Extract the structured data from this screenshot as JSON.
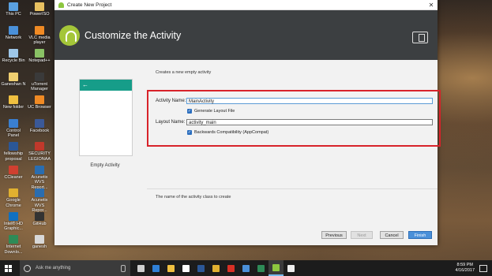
{
  "desktop": {
    "icons": [
      {
        "label": "This PC",
        "color": "#5aa0e0"
      },
      {
        "label": "PowerISO",
        "color": "#e8c060"
      },
      {
        "label": "Network",
        "color": "#4a90d9"
      },
      {
        "label": "VLC media player",
        "color": "#f08a24"
      },
      {
        "label": "Recycle Bin",
        "color": "#9ec7e8"
      },
      {
        "label": "Notepad++",
        "color": "#8ac265"
      },
      {
        "label": "Ganeshan N",
        "color": "#f0d070"
      },
      {
        "label": "uTorrent Manager",
        "color": "#3a3a3a"
      },
      {
        "label": "New folder",
        "color": "#f0c040"
      },
      {
        "label": "UC Browser",
        "color": "#f08a24"
      },
      {
        "label": "Control Panel",
        "color": "#3a7fd0"
      },
      {
        "label": "Facebook",
        "color": "#3b5998"
      },
      {
        "label": "fellowship proposal",
        "color": "#2b5797"
      },
      {
        "label": "SECURITY LEGIONAA",
        "color": "#c0392b"
      },
      {
        "label": "CCleaner",
        "color": "#d04030"
      },
      {
        "label": "Acunetix WVS Report...",
        "color": "#2a6db0"
      },
      {
        "label": "Google Chrome",
        "color": "#e0b030"
      },
      {
        "label": "Acunetix WVS Repor...",
        "color": "#2a6db0"
      },
      {
        "label": "Intel® HD Graphic...",
        "color": "#1070c0"
      },
      {
        "label": "GitHub",
        "color": "#333333"
      },
      {
        "label": "Internet Downlo...",
        "color": "#2e8b57"
      },
      {
        "label": "ganesh",
        "color": "#d8d8d8"
      }
    ]
  },
  "window": {
    "title": "Create New Project",
    "close": "✕",
    "heading": "Customize the Activity",
    "description": "Creates a new empty activity",
    "preview": {
      "back_arrow": "←",
      "label": "Empty Activity"
    },
    "form": {
      "activity_name_label": "Activity Name:",
      "activity_name_value": "MainActivity",
      "generate_layout_label": "Generate Layout File",
      "layout_name_label": "Layout Name:",
      "layout_name_value": "activity_main",
      "backwards_compat_label": "Backwards Compatibility (AppCompat)",
      "check_mark": "✓"
    },
    "help_text": "The name of the activity class to create",
    "buttons": {
      "previous": "Previous",
      "next": "Next",
      "cancel": "Cancel",
      "finish": "Finish"
    }
  },
  "taskbar": {
    "search_placeholder": "Ask me anything",
    "apps": [
      {
        "name": "task-view",
        "color": "#cfcfcf"
      },
      {
        "name": "edge",
        "color": "#2f7fd6"
      },
      {
        "name": "file-explorer",
        "color": "#f0c040"
      },
      {
        "name": "store",
        "color": "#ffffff"
      },
      {
        "name": "word",
        "color": "#2b5797"
      },
      {
        "name": "chrome",
        "color": "#e0b030"
      },
      {
        "name": "acrobat",
        "color": "#d93025"
      },
      {
        "name": "app-blue",
        "color": "#4a90d9"
      },
      {
        "name": "explorer",
        "color": "#2e8b57"
      },
      {
        "name": "android-studio",
        "color": "#8dc63f"
      },
      {
        "name": "media",
        "color": "#eeeeee"
      }
    ],
    "time": "8:59 PM",
    "date": "4/16/2017"
  }
}
